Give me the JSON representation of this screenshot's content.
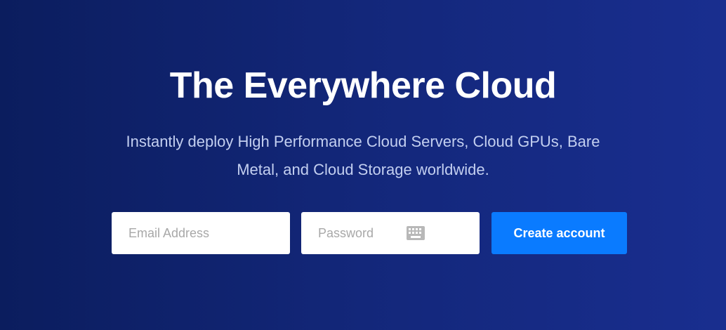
{
  "hero": {
    "title": "The Everywhere Cloud",
    "subtitle": "Instantly deploy High Performance Cloud Servers, Cloud GPUs, Bare Metal, and Cloud Storage worldwide."
  },
  "signup_form": {
    "email_placeholder": "Email Address",
    "email_value": "",
    "password_placeholder": "Password",
    "password_value": "",
    "password_icon": "keyboard-icon",
    "submit_label": "Create account"
  },
  "colors": {
    "background_start": "#0b1d5e",
    "background_end": "#192e8f",
    "accent_button": "#0a7bff",
    "subtitle_text": "#c3cff0"
  }
}
